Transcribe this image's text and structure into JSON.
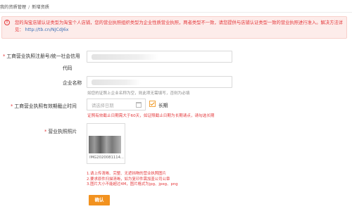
{
  "breadcrumb": {
    "parent": "我的资质管理",
    "separator": "/",
    "current": "新增资质"
  },
  "notice": {
    "icon": "exclamation-circle-icon",
    "text": "您的淘宝店铺认证类型为淘宝个人店铺，您的营业执照组织类型为企业性质营业执照，两者类型不一致，请您提供与店铺认证类型一致的营业执照进行准入。解决方法详见：",
    "link": "http://tb.cn/NJCdJ6x"
  },
  "form": {
    "reg_number": {
      "required_mark": "*",
      "label_line1": "工商营业执照注册号/统一社会信用",
      "label_line2": "代码"
    },
    "company_name": {
      "label": "企业名称",
      "help": "如您的证照上企业名称为空，则此项无需填写，否则为必填"
    },
    "expiry": {
      "required_mark": "*",
      "label": "工商营业执照有效期截止时间",
      "placeholder": "请选择日期",
      "checkbox_label": "长期",
      "checkbox_checked": true,
      "error": "证照有效截止日期需大于60天，如证照截止日期为长期请点，请勾选长期"
    },
    "photo": {
      "required_mark": "*",
      "label": "营业执照照片",
      "file_name": "IMG2020081114...",
      "requirements": [
        "1.请上传清晰、完整、无遮挡物的营业执照图片",
        "2.要求原件扫描清晰，如为复印件需加盖公司公章",
        "3.图片大小不能超过4M，图片格式为jpg、jpeg、png"
      ]
    }
  },
  "actions": {
    "confirm_label": "确认"
  },
  "colors": {
    "accent": "#f2921f",
    "error": "#e4393c",
    "link": "#3b6fb6"
  }
}
